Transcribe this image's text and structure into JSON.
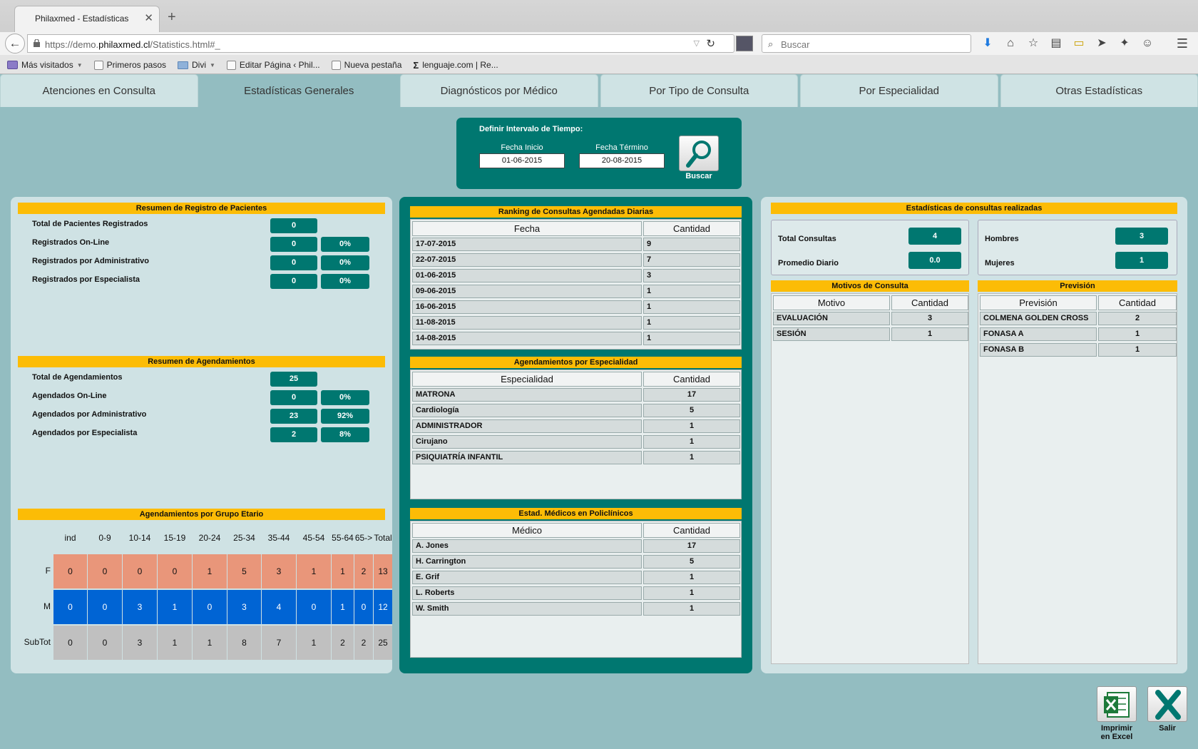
{
  "browser": {
    "tab_title": "Philaxmed - Estadísticas",
    "url_prefix": "https://demo.",
    "url_domain": "philaxmed.cl",
    "url_suffix": "/Statistics.html#_",
    "search_placeholder": "Buscar",
    "bookmarks": [
      "Más visitados",
      "Primeros pasos",
      "Divi",
      "Editar Página ‹ Phil...",
      "Nueva pestaña",
      "lenguaje.com | Re..."
    ]
  },
  "tabs": [
    "Atenciones en Consulta",
    "Estadísticas Generales",
    "Diagnósticos por Médico",
    "Por Tipo de Consulta",
    "Por Especialidad",
    "Otras Estadísticas"
  ],
  "filter": {
    "title": "Definir Intervalo de Tiempo:",
    "start_label": "Fecha Inicio",
    "start_value": "01-06-2015",
    "end_label": "Fecha Término",
    "end_value": "20-08-2015",
    "search_label": "Buscar"
  },
  "patients": {
    "title": "Resumen de Registro de Pacientes",
    "rows": [
      {
        "label": "Total de Pacientes Registrados",
        "value": "0",
        "pct": ""
      },
      {
        "label": "Registrados On-Line",
        "value": "0",
        "pct": "0%"
      },
      {
        "label": "Registrados por Administrativo",
        "value": "0",
        "pct": "0%"
      },
      {
        "label": "Registrados por Especialista",
        "value": "0",
        "pct": "0%"
      }
    ]
  },
  "appointments": {
    "title": "Resumen de Agendamientos",
    "rows": [
      {
        "label": "Total de Agendamientos",
        "value": "25",
        "pct": ""
      },
      {
        "label": "Agendados On-Line",
        "value": "0",
        "pct": "0%"
      },
      {
        "label": "Agendados por Administrativo",
        "value": "23",
        "pct": "92%"
      },
      {
        "label": "Agendados por Especialista",
        "value": "2",
        "pct": "8%"
      }
    ]
  },
  "age_groups": {
    "title": "Agendamientos por Grupo Etario",
    "headers": [
      "ind",
      "0-9",
      "10-14",
      "15-19",
      "20-24",
      "25-34",
      "35-44",
      "45-54",
      "55-64",
      "65->",
      "Total"
    ],
    "row_labels": [
      "F",
      "M",
      "SubTot"
    ],
    "F": [
      "0",
      "0",
      "0",
      "0",
      "1",
      "5",
      "3",
      "1",
      "1",
      "2",
      "13"
    ],
    "M": [
      "0",
      "0",
      "3",
      "1",
      "0",
      "3",
      "4",
      "0",
      "1",
      "0",
      "12"
    ],
    "SubTot": [
      "0",
      "0",
      "3",
      "1",
      "1",
      "8",
      "7",
      "1",
      "2",
      "2",
      "25"
    ]
  },
  "ranking": {
    "title": "Ranking de Consultas Agendadas Diarias",
    "col1": "Fecha",
    "col2": "Cantidad",
    "rows": [
      [
        "17-07-2015",
        "9"
      ],
      [
        "22-07-2015",
        "7"
      ],
      [
        "01-06-2015",
        "3"
      ],
      [
        "09-06-2015",
        "1"
      ],
      [
        "16-06-2015",
        "1"
      ],
      [
        "11-08-2015",
        "1"
      ],
      [
        "14-08-2015",
        "1"
      ]
    ]
  },
  "specialty": {
    "title": "Agendamientos por Especialidad",
    "col1": "Especialidad",
    "col2": "Cantidad",
    "rows": [
      [
        "MATRONA",
        "17"
      ],
      [
        "Cardiología",
        "5"
      ],
      [
        "ADMINISTRADOR",
        "1"
      ],
      [
        "Cirujano",
        "1"
      ],
      [
        "PSIQUIATRÍA INFANTIL",
        "1"
      ]
    ]
  },
  "doctors": {
    "title": "Estad. Médicos en Policlínicos",
    "col1": "Médico",
    "col2": "Cantidad",
    "rows": [
      [
        "A. Jones",
        "17"
      ],
      [
        "H. Carrington",
        "5"
      ],
      [
        "E. Grif",
        "1"
      ],
      [
        "L. Roberts",
        "1"
      ],
      [
        "W. Smith",
        "1"
      ]
    ]
  },
  "consults": {
    "title": "Estadísticas de consultas realizadas",
    "total_label": "Total Consultas",
    "total_value": "4",
    "avg_label": "Promedio Diario",
    "avg_value": "0.0",
    "men_label": "Hombres",
    "men_value": "3",
    "women_label": "Mujeres",
    "women_value": "1"
  },
  "motivos": {
    "title": "Motivos de Consulta",
    "col1": "Motivo",
    "col2": "Cantidad",
    "rows": [
      [
        "EVALUACIÓN",
        "3"
      ],
      [
        "SESIÓN",
        "1"
      ]
    ]
  },
  "prevision": {
    "title": "Previsión",
    "col1": "Previsión",
    "col2": "Cantidad",
    "rows": [
      [
        "COLMENA GOLDEN CROSS",
        "2"
      ],
      [
        "FONASA A",
        "1"
      ],
      [
        "FONASA B",
        "1"
      ]
    ]
  },
  "footer": {
    "excel_label_1": "Imprimir",
    "excel_label_2": "en Excel",
    "exit_label": "Salir"
  },
  "colors": {
    "teal": "#007770",
    "yellow": "#fcbc06",
    "female": "#e9967a",
    "male": "#0064d4",
    "subtotal": "#c0c0c0"
  }
}
